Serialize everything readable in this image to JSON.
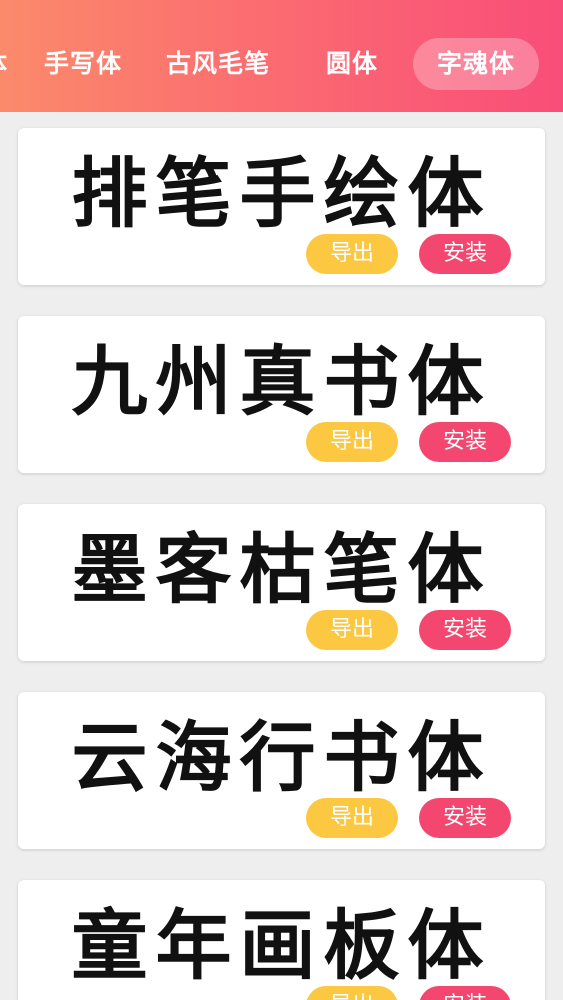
{
  "tabs": [
    {
      "label": "体"
    },
    {
      "label": "手写体"
    },
    {
      "label": "古风毛笔"
    },
    {
      "label": "圆体"
    },
    {
      "label": "字魂体",
      "active": true
    }
  ],
  "fonts": [
    {
      "preview": "排笔手绘体",
      "export_label": "导出",
      "install_label": "安装"
    },
    {
      "preview": "九州真书体",
      "export_label": "导出",
      "install_label": "安装"
    },
    {
      "preview": "墨客枯笔体",
      "export_label": "导出",
      "install_label": "安装"
    },
    {
      "preview": "云海行书体",
      "export_label": "导出",
      "install_label": "安装"
    },
    {
      "preview": "童年画板体",
      "export_label": "导出",
      "install_label": "安装"
    }
  ],
  "colors": {
    "header_start": "#fb8a6b",
    "header_end": "#f94d79",
    "export_button": "#fcc741",
    "install_button": "#f3476f",
    "background": "#eeeeee"
  }
}
